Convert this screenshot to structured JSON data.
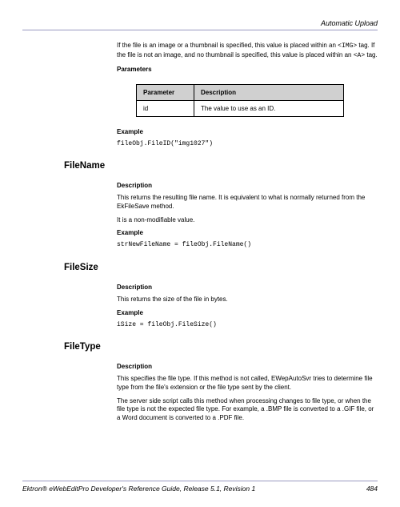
{
  "header": {
    "title": "Automatic Upload"
  },
  "intro": {
    "p1_a": "If the file is an image or a thumbnail is specified, this value is placed within an ",
    "p1_code1": "<IMG>",
    "p1_b": " tag. If the file is not an image, and no thumbnail is specified, this value is placed within an ",
    "p1_code2": "<A>",
    "p1_c": " tag.",
    "params_label": "Parameters"
  },
  "table": {
    "h1": "Parameter",
    "h2": "Description",
    "r1c1": "id",
    "r1c2": "The value to use as an ID."
  },
  "example1": {
    "label": "Example",
    "code": "fileObj.FileID(\"img1027\")"
  },
  "filename": {
    "heading": "FileName",
    "desc_label": "Description",
    "desc1": "This returns the resulting file name. It is equivalent to what is normally returned from the EkFileSave method.",
    "desc2": "It is a non-modifiable value.",
    "ex_label": "Example",
    "code": "strNewFileName = fileObj.FileName()"
  },
  "filesize": {
    "heading": "FileSize",
    "desc_label": "Description",
    "desc": "This returns the size of the file in bytes.",
    "ex_label": "Example",
    "code": "iSize = fileObj.FileSize()"
  },
  "filetype": {
    "heading": "FileType",
    "desc_label": "Description",
    "desc1": "This specifies the file type. If this method is not called, EWepAutoSvr tries to determine file type from the file's extension or the file type sent by the client.",
    "desc2": "The server side script calls this method when processing changes to file type, or when the file type is not the expected file type. For example, a .BMP file is converted to a .GIF file, or a Word document is converted to a .PDF file."
  },
  "footer": {
    "left": "Ektron® eWebEditPro Developer's Reference Guide, Release 5.1, Revision 1",
    "right": "484"
  }
}
